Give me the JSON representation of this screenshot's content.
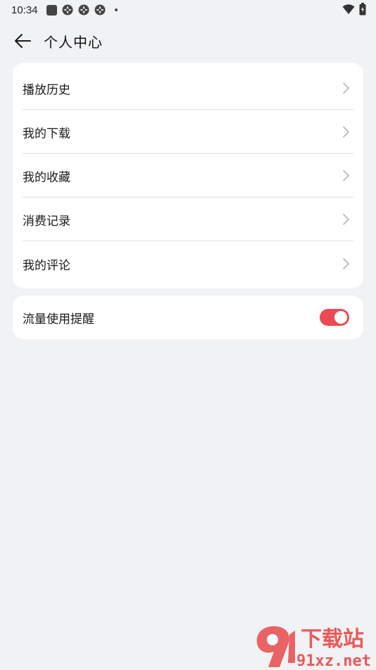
{
  "status_bar": {
    "time": "10:34",
    "left_icons": [
      "square-notification-icon",
      "app-notification-icon",
      "app-notification-icon",
      "app-notification-icon",
      "dot-icon"
    ],
    "right_icons": [
      "wifi-icon",
      "battery-icon"
    ]
  },
  "header": {
    "title": "个人中心",
    "back_icon": "arrow-left-icon"
  },
  "menu": {
    "items": [
      {
        "label": "播放历史",
        "icon": "chevron-right-icon"
      },
      {
        "label": "我的下载",
        "icon": "chevron-right-icon"
      },
      {
        "label": "我的收藏",
        "icon": "chevron-right-icon"
      },
      {
        "label": "消费记录",
        "icon": "chevron-right-icon"
      },
      {
        "label": "我的评论",
        "icon": "chevron-right-icon"
      }
    ]
  },
  "settings": {
    "data_reminder_label": "流量使用提醒",
    "data_reminder_enabled": true
  },
  "watermark": {
    "brand": "下载站",
    "url": "91xz.net",
    "logo": "9"
  },
  "colors": {
    "background": "#f1f2f4",
    "card": "#ffffff",
    "accent": "#ea4b52",
    "divider": "#e1e2e4",
    "chevron": "#b5b5b8"
  }
}
